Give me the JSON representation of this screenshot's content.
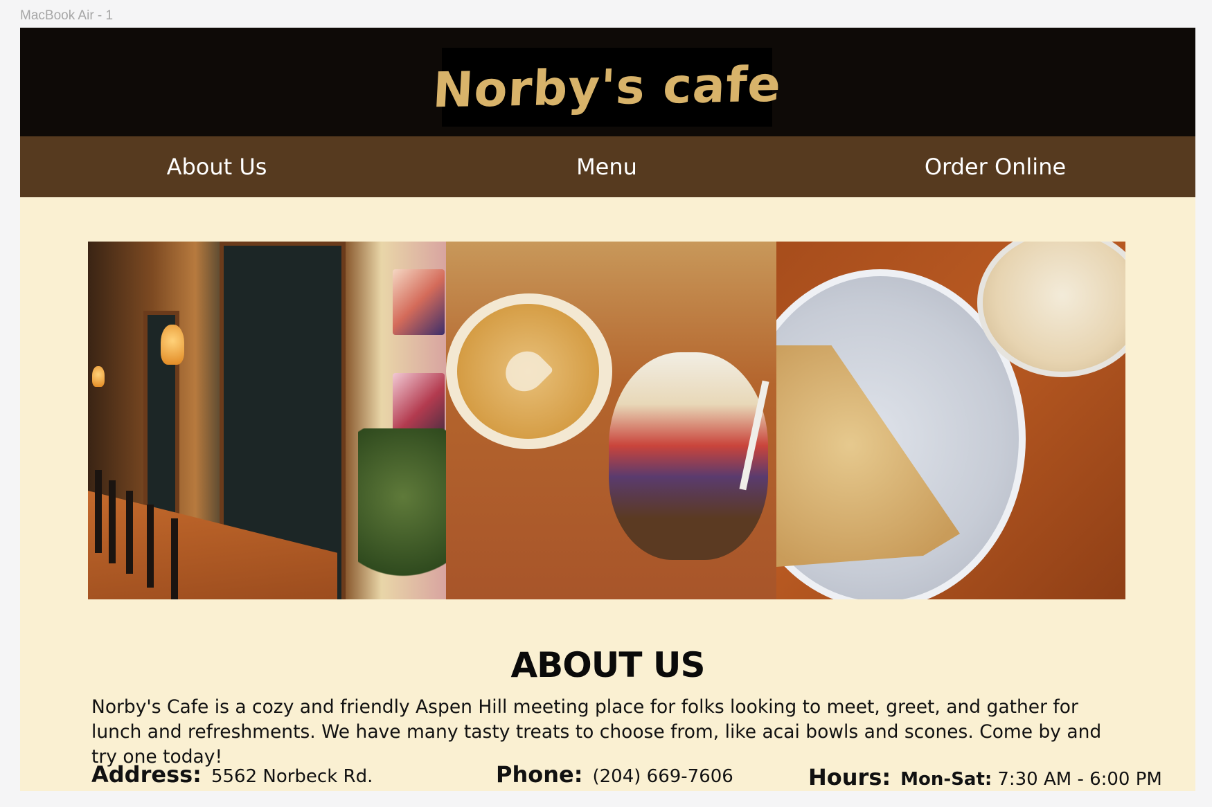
{
  "canvas": {
    "frame_label": "MacBook Air - 1"
  },
  "header": {
    "logo_text": "Norby's cafe"
  },
  "nav": {
    "items": [
      {
        "label": "About Us"
      },
      {
        "label": "Menu"
      },
      {
        "label": "Order Online"
      }
    ]
  },
  "gallery": {
    "photos": [
      {
        "name": "cafe-interior-photo"
      },
      {
        "name": "latte-and-acai-bowl-photo"
      },
      {
        "name": "scone-and-dessert-photo"
      }
    ]
  },
  "about": {
    "title": "ABOUT US",
    "text": "Norby's Cafe is a cozy and friendly Aspen Hill meeting place for folks looking to meet, greet, and gather for lunch and refreshments. We have many tasty treats to choose from, like acai bowls and scones. Come by and try one today!"
  },
  "info": {
    "address_label": "Address:",
    "address_value": "5562 Norbeck Rd.",
    "phone_label": "Phone:",
    "phone_value": "(204) 669-7606",
    "hours_label": "Hours:",
    "hours_days": "Mon-Sat:",
    "hours_value": "7:30 AM - 6:00 PM"
  },
  "colors": {
    "header_bg": "#0e0a07",
    "nav_bg": "#563a1f",
    "page_bg": "#faf0d2",
    "logo_text": "#d8b36a"
  }
}
